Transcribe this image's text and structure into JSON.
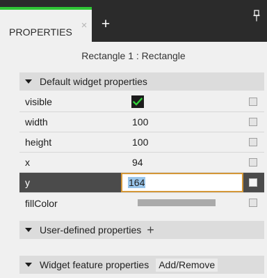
{
  "tabs": [
    {
      "label": "PROPERTIES",
      "active": true,
      "close_icon": "close-icon"
    }
  ],
  "toolbar": {
    "add_tab_icon": "plus-icon",
    "pin_icon": "pin-icon"
  },
  "colors": {
    "accent": "#2fc635",
    "tab_bar": "#2b2b2b",
    "section_header": "#dcdcdc",
    "selected_row": "#4b4b4b",
    "edit_border": "#d49738",
    "text_selection": "#99c5ea"
  },
  "selection": {
    "title": "Rectangle 1 : Rectangle"
  },
  "sections": {
    "default": {
      "label": "Default widget properties",
      "expanded": true,
      "caret_icon": "chevron-down-icon"
    },
    "user_defined": {
      "label": "User-defined properties",
      "add_icon": "plus-icon"
    },
    "widget_feature": {
      "label": "Widget feature properties",
      "action_label": "Add/Remove"
    }
  },
  "properties": [
    {
      "name": "visible",
      "value": "",
      "checked": true
    },
    {
      "name": "width",
      "value": "100"
    },
    {
      "name": "height",
      "value": "100"
    },
    {
      "name": "x",
      "value": "94"
    },
    {
      "name": "y",
      "value": "164",
      "selected": true
    },
    {
      "name": "fillColor",
      "swatch_color": "#aaaaaa"
    }
  ]
}
